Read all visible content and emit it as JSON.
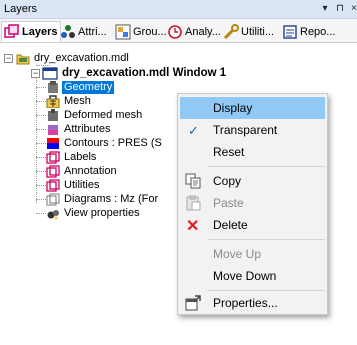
{
  "panel": {
    "title": "Layers",
    "pin_glyph": "▾",
    "dock_glyph": "⊓",
    "close_glyph": "×"
  },
  "tabs": [
    {
      "label": "Layers",
      "icon": "layers-icon"
    },
    {
      "label": "Attri...",
      "icon": "attributes-icon"
    },
    {
      "label": "Grou...",
      "icon": "groups-icon"
    },
    {
      "label": "Analy...",
      "icon": "analysis-icon"
    },
    {
      "label": "Utiliti...",
      "icon": "utilities-icon"
    },
    {
      "label": "Repo...",
      "icon": "reports-icon"
    }
  ],
  "tree": {
    "root": "dry_excavation.mdl",
    "window": "dry_excavation.mdl Window 1",
    "items": [
      {
        "label": "Geometry",
        "icon": "geometry-icon",
        "selected": true
      },
      {
        "label": "Mesh",
        "icon": "mesh-icon"
      },
      {
        "label": "Deformed mesh",
        "icon": "deformed-mesh-icon"
      },
      {
        "label": "Attributes",
        "icon": "attributes-layer-icon"
      },
      {
        "label": "Contours : PRES (S",
        "icon": "contours-icon"
      },
      {
        "label": "Labels",
        "icon": "labels-icon"
      },
      {
        "label": "Annotation",
        "icon": "annotation-icon"
      },
      {
        "label": "Utilities",
        "icon": "utilities-layer-icon"
      },
      {
        "label": "Diagrams : Mz (For",
        "icon": "diagrams-icon"
      },
      {
        "label": "View properties",
        "icon": "view-properties-icon"
      }
    ]
  },
  "context_menu": {
    "display": "Display",
    "transparent": "Transparent",
    "transparent_check": "✓",
    "reset": "Reset",
    "copy": "Copy",
    "paste": "Paste",
    "delete": "Delete",
    "delete_glyph": "✕",
    "move_up": "Move Up",
    "move_down": "Move Down",
    "properties": "Properties..."
  },
  "colors": {
    "selection": "#0078d7",
    "menu_highlight": "#90c8f6",
    "delete_red": "#e0201b",
    "panel_header": "#dbe6f4"
  }
}
